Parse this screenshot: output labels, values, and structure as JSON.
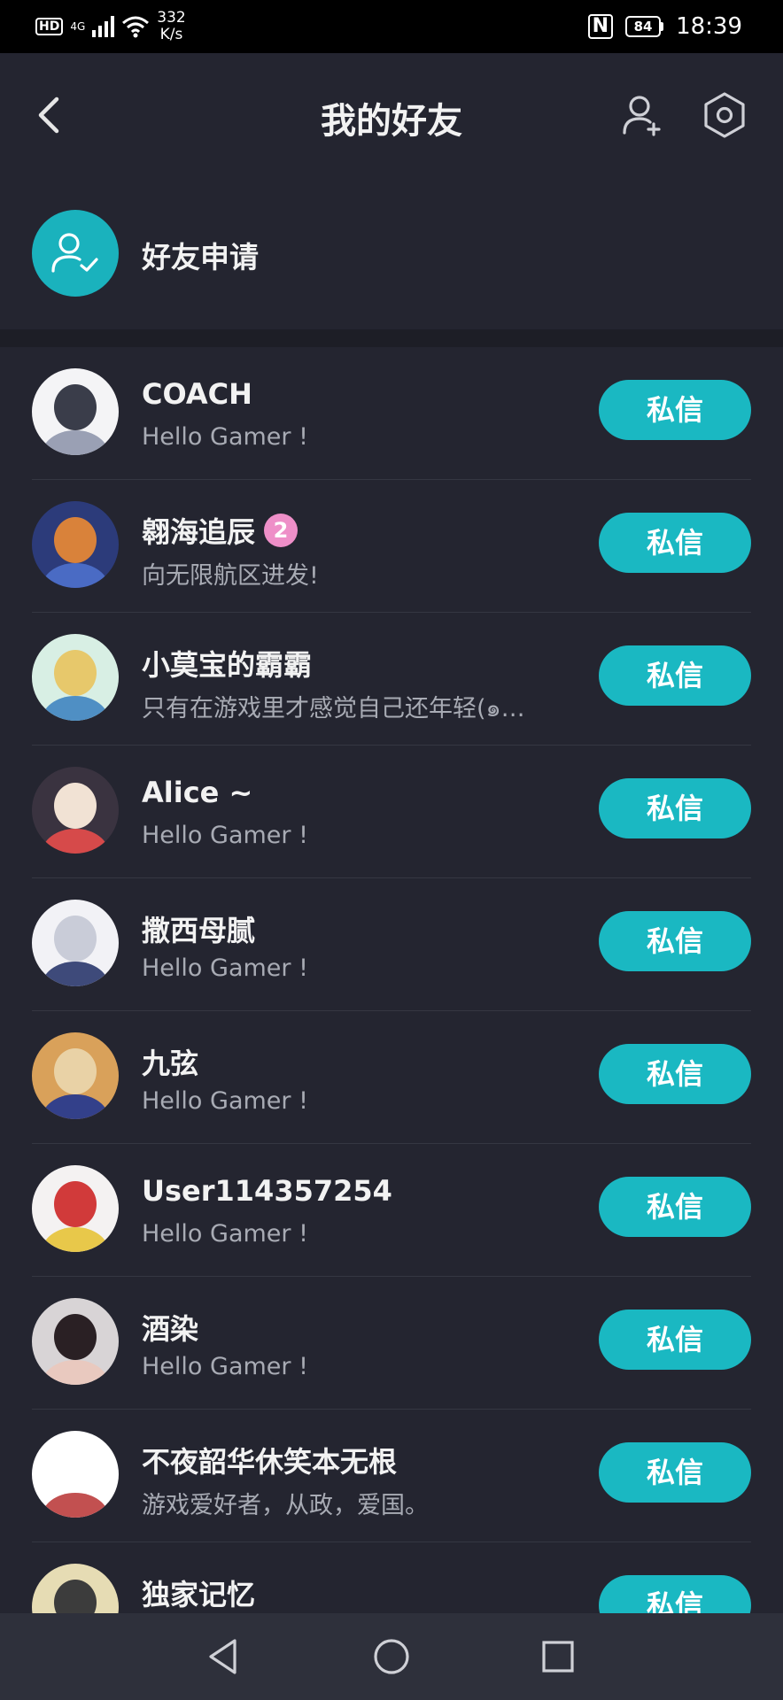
{
  "status_bar": {
    "hd": "HD",
    "network": "4G",
    "speed_value": "332",
    "speed_unit": "K/s",
    "nfc": "N",
    "battery": "84",
    "time": "18:39"
  },
  "header": {
    "title": "我的好友",
    "back_icon": "chevron-left-icon",
    "add_friend_icon": "person-add-icon",
    "settings_icon": "hexagon-gear-icon"
  },
  "friend_request": {
    "label": "好友申请",
    "icon": "person-check-icon",
    "icon_bg": "#1ab2bd"
  },
  "friends": [
    {
      "name": "COACH",
      "signature": "Hello Gamer !",
      "button": "私信",
      "avatar_colors": [
        "#f4f4f6",
        "#3a3d4a",
        "#9aa0b4"
      ]
    },
    {
      "name": "翱海追辰",
      "badge": "2",
      "signature": "向无限航区进发!",
      "button": "私信",
      "avatar_colors": [
        "#2c3b7a",
        "#d9823a",
        "#4a6bc4"
      ]
    },
    {
      "name": "小莫宝的霸霸",
      "signature": "只有在游戏里才感觉自己还年轻(๑…",
      "button": "私信",
      "avatar_colors": [
        "#d8efe4",
        "#e7c86b",
        "#4f8fc4"
      ]
    },
    {
      "name": "Alice ~",
      "signature": "Hello Gamer !",
      "button": "私信",
      "avatar_colors": [
        "#3a3340",
        "#f1e2d4",
        "#d64a4a"
      ]
    },
    {
      "name": "撒西母腻",
      "signature": "Hello Gamer !",
      "button": "私信",
      "avatar_colors": [
        "#f2f2f6",
        "#c9ccd8",
        "#3e4a7a"
      ]
    },
    {
      "name": "九弦",
      "signature": "Hello Gamer !",
      "button": "私信",
      "avatar_colors": [
        "#d9a15a",
        "#e9d2a6",
        "#33408a"
      ]
    },
    {
      "name": "User114357254",
      "signature": "Hello Gamer !",
      "button": "私信",
      "avatar_colors": [
        "#f4f2f2",
        "#d13a3a",
        "#e8c84a"
      ]
    },
    {
      "name": "酒染",
      "signature": "Hello Gamer !",
      "button": "私信",
      "avatar_colors": [
        "#d8d4d6",
        "#2a2024",
        "#e9c9bf"
      ]
    },
    {
      "name": "不夜韶华休笑本无根",
      "signature": "游戏爱好者，从政，爱国。",
      "button": "私信",
      "avatar_colors": [
        "#ffffff",
        "#ffffff",
        "#c25050"
      ]
    },
    {
      "name": "独家记忆",
      "signature": "",
      "button": "私信",
      "avatar_colors": [
        "#e6dcb4",
        "#3c3c3c",
        "#a9b67a"
      ]
    }
  ],
  "nav": {
    "back_icon": "triangle-back-icon",
    "home_icon": "circle-home-icon",
    "recents_icon": "square-recents-icon"
  },
  "colors": {
    "background": "#242530",
    "accent": "#1ab8c2",
    "badge": "#ee8fc8",
    "secondary_text": "#a8abb4"
  }
}
